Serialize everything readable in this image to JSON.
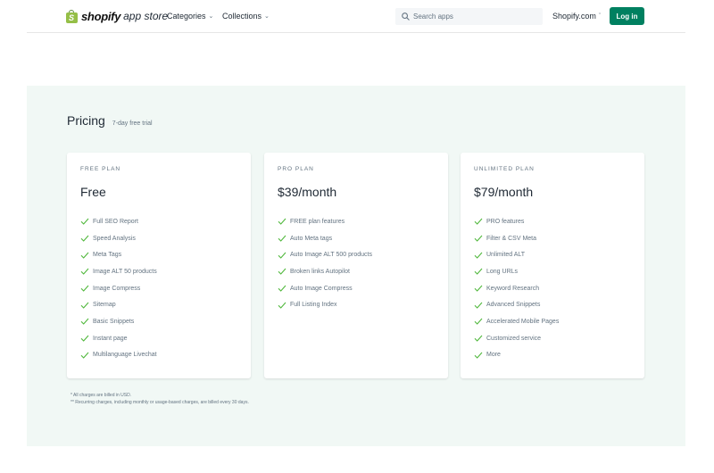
{
  "header": {
    "logo_brand": "shopify",
    "logo_suffix": "app store",
    "nav": [
      {
        "label": "Categories"
      },
      {
        "label": "Collections"
      }
    ],
    "search_placeholder": "Search apps",
    "store_link": "Shopify.com",
    "login_label": "Log in"
  },
  "pricing": {
    "title": "Pricing",
    "trial": "7-day free trial",
    "plans": [
      {
        "name": "FREE PLAN",
        "price": "Free",
        "features": [
          "Full SEO Report",
          "Speed Analysis",
          "Meta Tags",
          "Image ALT 50 products",
          "Image Compress",
          "Sitemap",
          "Basic Snippets",
          "Instant page",
          "Multilanguage Livechat"
        ]
      },
      {
        "name": "PRO PLAN",
        "price": "$39/month",
        "features": [
          "FREE plan features",
          "Auto Meta tags",
          "Auto Image ALT 500 products",
          "Broken links Autopilot",
          "Auto Image Compress",
          "Full Listing Index"
        ]
      },
      {
        "name": "UNLIMITED PLAN",
        "price": "$79/month",
        "features": [
          "PRO features",
          "Filter & CSV Meta",
          "Unlimited ALT",
          "Long URLs",
          "Keyword Research",
          "Advanced Snippets",
          "Accelerated Mobile Pages",
          "Customized service",
          "More"
        ]
      }
    ],
    "footnotes": [
      "* All charges are billed in USD.",
      "** Recurring charges, including monthly or usage-based charges, are billed every 30 days."
    ]
  },
  "colors": {
    "accent": "#008060",
    "check": "#50b83c",
    "section_bg": "#f1f8f5"
  }
}
